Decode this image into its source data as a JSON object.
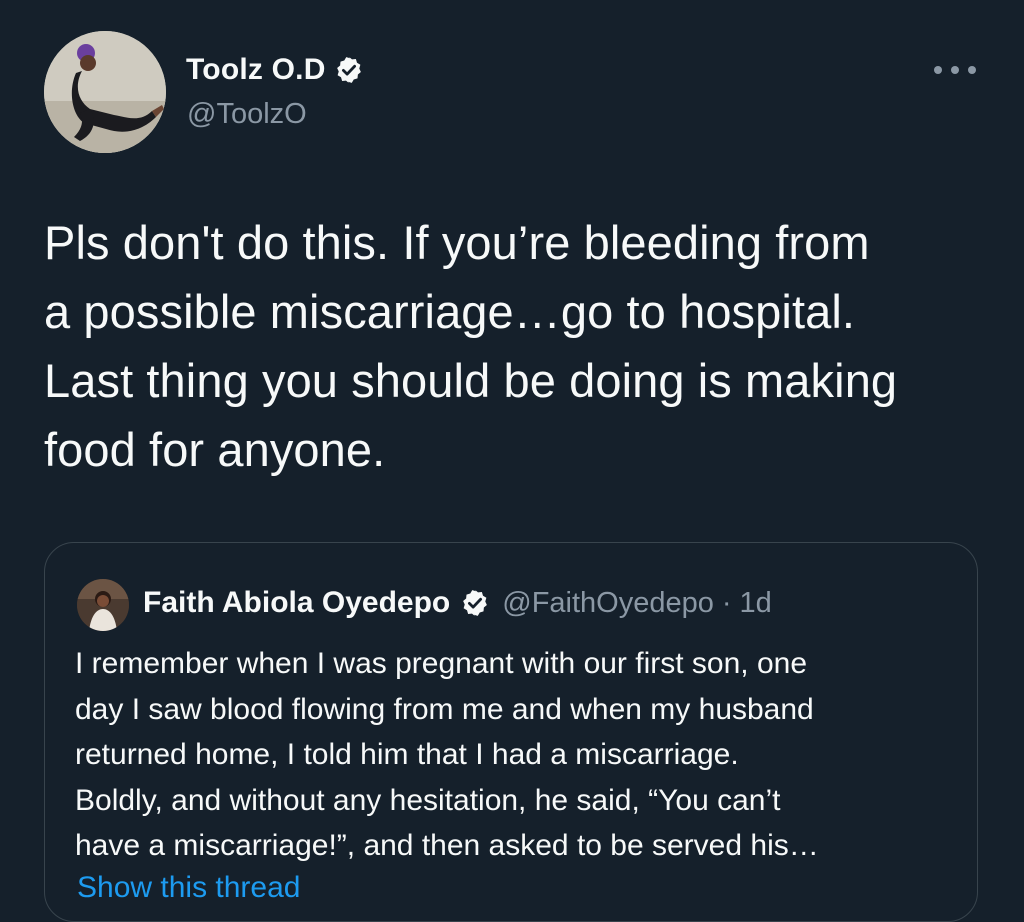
{
  "author": {
    "name": "Toolz O.D",
    "handle": "@ToolzO",
    "verified": true,
    "avatar_icon": "profile-photo-icon"
  },
  "tweet": {
    "text": "Pls don't do this. If you’re bleeding from\na possible miscarriage…go to hospital.\nLast thing you should be doing is making\nfood for anyone."
  },
  "quoted_tweet": {
    "name": "Faith Abiola Oyedepo",
    "handle": "@FaithOyedepo",
    "separator": "·",
    "time": "1d",
    "verified": true,
    "text": "I remember when I was pregnant with our first son, one\nday I saw blood flowing from me and when my husband\nreturned home, I told him that I had a miscarriage.\nBoldly, and without any hesitation, he said, “You can’t\nhave a miscarriage!”, and then asked to be served his…",
    "show_thread": "Show this thread"
  },
  "colors": {
    "background": "#15202b",
    "text_primary": "#f7f9f9",
    "text_secondary": "#8b98a5",
    "border": "#38444d",
    "link": "#1d9bf0"
  }
}
